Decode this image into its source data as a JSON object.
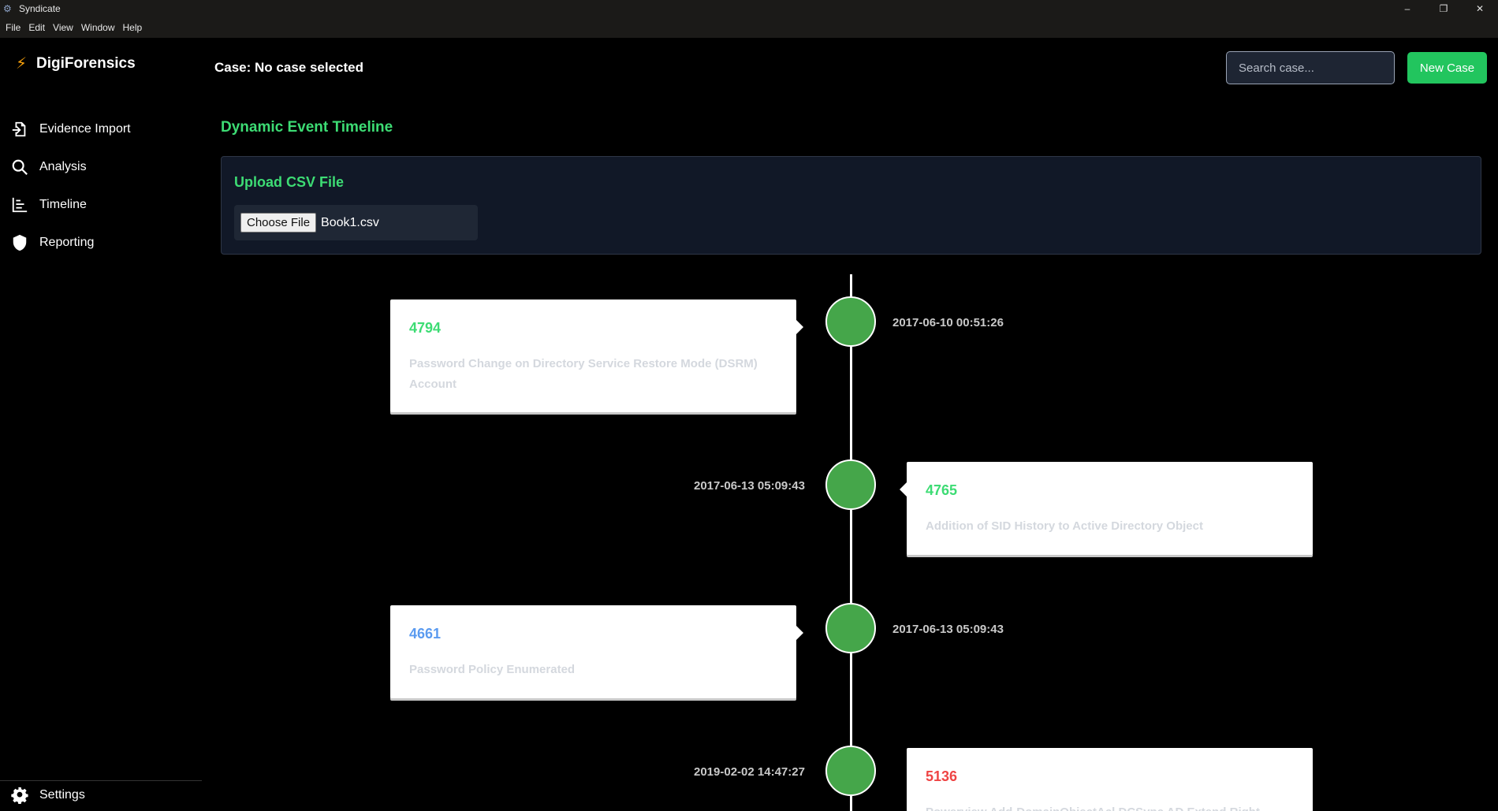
{
  "window": {
    "title": "Syndicate",
    "menu": [
      "File",
      "Edit",
      "View",
      "Window",
      "Help"
    ],
    "controls": [
      "–",
      "❐",
      "✕"
    ]
  },
  "sidebar": {
    "brand": "DigiForensics",
    "items": [
      {
        "label": "Evidence Import",
        "icon": "file-import-icon"
      },
      {
        "label": "Analysis",
        "icon": "search-icon"
      },
      {
        "label": "Timeline",
        "icon": "chart-icon"
      },
      {
        "label": "Reporting",
        "icon": "shield-icon"
      }
    ],
    "settings_label": "Settings"
  },
  "header": {
    "case_label": "Case: No case selected",
    "search_placeholder": "Search case...",
    "new_case_label": "New Case"
  },
  "main": {
    "title": "Dynamic Event Timeline",
    "upload": {
      "title": "Upload CSV File",
      "button_label": "Choose File",
      "file_name": "Book1.csv"
    }
  },
  "timeline": {
    "events": [
      {
        "id": "4794",
        "id_color": "#3ddc74",
        "timestamp": "2017-06-10 00:51:26",
        "description": "Password Change on Directory Service Restore Mode (DSRM) Account"
      },
      {
        "id": "4765",
        "id_color": "#3ddc74",
        "timestamp": "2017-06-13 05:09:43",
        "description": "Addition of SID History to Active Directory Object"
      },
      {
        "id": "4661",
        "id_color": "#5b9bf0",
        "timestamp": "2017-06-13 05:09:43",
        "description": "Password Policy Enumerated"
      },
      {
        "id": "5136",
        "id_color": "#ef4444",
        "timestamp": "2019-02-02 14:47:27",
        "description": "Powerview Add-DomainObjectAcl DCSync AD Extend Right"
      }
    ]
  }
}
